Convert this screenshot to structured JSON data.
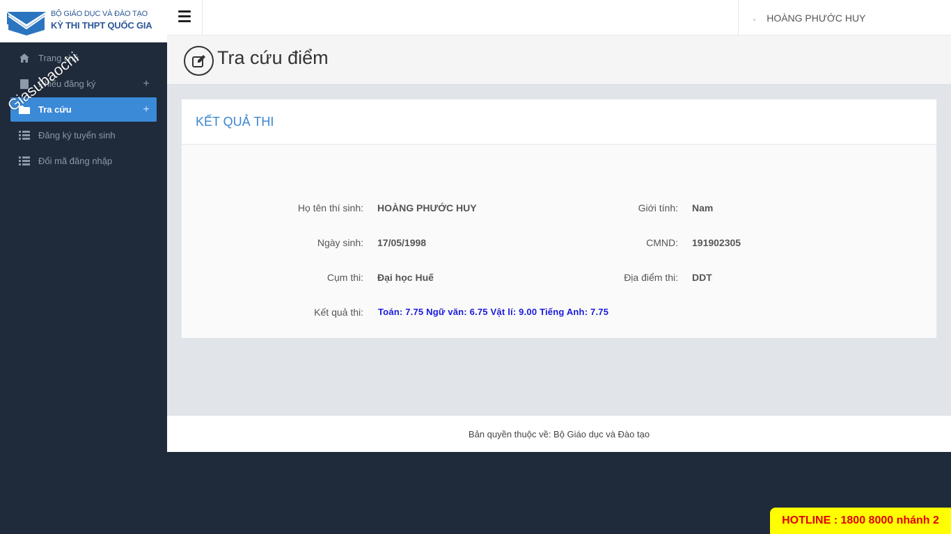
{
  "logo": {
    "line1": "BỘ GIÁO DỤC VÀ ĐÀO TẠO",
    "line2": "KỲ THI THPT QUỐC GIA",
    "icon": "graduation-cap-envelope-icon",
    "brand_color": "#2b5797"
  },
  "watermark": "Giasubaochi",
  "header": {
    "menu_icon": "hamburger-icon",
    "user_icon": "user-dot-icon",
    "user_name": "HOÀNG PHƯỚC HUY"
  },
  "sidebar": {
    "items": [
      {
        "label": "Trang chủ",
        "icon": "home-icon",
        "expandable": false,
        "active": false
      },
      {
        "label": "Phiếu đăng ký",
        "icon": "file-icon",
        "expandable": true,
        "plus": "+",
        "active": false
      },
      {
        "label": "Tra cứu",
        "icon": "folder-icon",
        "expandable": true,
        "plus": "+",
        "active": true
      },
      {
        "label": "Đăng ký tuyển sinh",
        "icon": "list-icon",
        "expandable": false,
        "active": false
      },
      {
        "label": "Đổi mã đăng nhập",
        "icon": "list-icon",
        "expandable": false,
        "active": false
      }
    ],
    "active_color": "#3b8ad8"
  },
  "page": {
    "title": "Tra cứu điểm",
    "title_icon": "edit-icon"
  },
  "card": {
    "title": "KẾT QUẢ THI",
    "fields": {
      "name_label": "Họ tên thí sinh:",
      "name_value": "HOÀNG PHƯỚC HUY",
      "gender_label": "Giới tính:",
      "gender_value": "Nam",
      "dob_label": "Ngày sinh:",
      "dob_value": "17/05/1998",
      "id_label": "CMND:",
      "id_value": "191902305",
      "cluster_label": "Cụm thi:",
      "cluster_value": "Đại học Huế",
      "venue_label": "Địa điểm thi:",
      "venue_value": "DDT",
      "result_label": "Kết quả thi:",
      "result_value": "Toán: 7.75 Ngữ văn: 6.75 Vật lí: 9.00 Tiếng Anh: 7.75"
    },
    "title_color": "#3a87cf",
    "result_color": "#1a1adc"
  },
  "footer": {
    "text": "Bản quyền thuộc về: Bộ Giáo dục và Đào tạo"
  },
  "hotline": {
    "text": "HOTLINE : 1800 8000 nhánh 2",
    "bg_color": "#ffff00",
    "text_color": "#e00000"
  }
}
